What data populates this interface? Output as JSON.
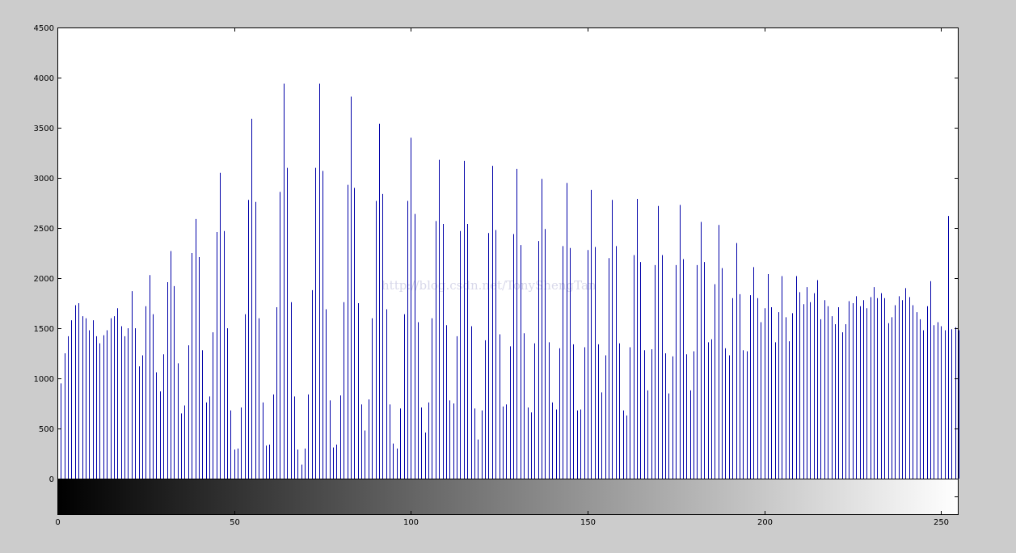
{
  "figure": {
    "background_color": "#cccccc",
    "axes_background_color": "#ffffff",
    "watermark": "http://blog.csdn.net/TonyShengTan"
  },
  "chart_data": {
    "type": "bar",
    "subtype": "stem",
    "title": "",
    "xlabel": "",
    "ylabel": "",
    "xlim": [
      0,
      255
    ],
    "ylim": [
      0,
      4500
    ],
    "xticks": [
      0,
      50,
      100,
      150,
      200,
      250
    ],
    "yticks": [
      0,
      500,
      1000,
      1500,
      2000,
      2500,
      3000,
      3500,
      4000,
      4500
    ],
    "grid": false,
    "legend": "none",
    "bar_color": "#0000a8",
    "colorbar": {
      "range": [
        0,
        255
      ],
      "from_color": "#000000",
      "to_color": "#ffffff"
    },
    "x": [
      0,
      1,
      2,
      3,
      4,
      5,
      6,
      7,
      8,
      9,
      10,
      11,
      12,
      13,
      14,
      15,
      16,
      17,
      18,
      19,
      20,
      21,
      22,
      23,
      24,
      25,
      26,
      27,
      28,
      29,
      30,
      31,
      32,
      33,
      34,
      35,
      36,
      37,
      38,
      39,
      40,
      41,
      42,
      43,
      44,
      45,
      46,
      47,
      48,
      49,
      50,
      51,
      52,
      53,
      54,
      55,
      56,
      57,
      58,
      59,
      60,
      61,
      62,
      63,
      64,
      65,
      66,
      67,
      68,
      69,
      70,
      71,
      72,
      73,
      74,
      75,
      76,
      77,
      78,
      79,
      80,
      81,
      82,
      83,
      84,
      85,
      86,
      87,
      88,
      89,
      90,
      91,
      92,
      93,
      94,
      95,
      96,
      97,
      98,
      99,
      100,
      101,
      102,
      103,
      104,
      105,
      106,
      107,
      108,
      109,
      110,
      111,
      112,
      113,
      114,
      115,
      116,
      117,
      118,
      119,
      120,
      121,
      122,
      123,
      124,
      125,
      126,
      127,
      128,
      129,
      130,
      131,
      132,
      133,
      134,
      135,
      136,
      137,
      138,
      139,
      140,
      141,
      142,
      143,
      144,
      145,
      146,
      147,
      148,
      149,
      150,
      151,
      152,
      153,
      154,
      155,
      156,
      157,
      158,
      159,
      160,
      161,
      162,
      163,
      164,
      165,
      166,
      167,
      168,
      169,
      170,
      171,
      172,
      173,
      174,
      175,
      176,
      177,
      178,
      179,
      180,
      181,
      182,
      183,
      184,
      185,
      186,
      187,
      188,
      189,
      190,
      191,
      192,
      193,
      194,
      195,
      196,
      197,
      198,
      199,
      200,
      201,
      202,
      203,
      204,
      205,
      206,
      207,
      208,
      209,
      210,
      211,
      212,
      213,
      214,
      215,
      216,
      217,
      218,
      219,
      220,
      221,
      222,
      223,
      224,
      225,
      226,
      227,
      228,
      229,
      230,
      231,
      232,
      233,
      234,
      235,
      236,
      237,
      238,
      239,
      240,
      241,
      242,
      243,
      244,
      245,
      246,
      247,
      248,
      249,
      250,
      251,
      252,
      253,
      254,
      255
    ],
    "values": [
      1480,
      950,
      1250,
      1420,
      1580,
      1730,
      1750,
      1620,
      1600,
      1480,
      1580,
      1420,
      1350,
      1430,
      1480,
      1600,
      1620,
      1700,
      1520,
      1420,
      1500,
      1870,
      1500,
      1120,
      1230,
      1720,
      2030,
      1640,
      1060,
      870,
      1240,
      1960,
      2270,
      1920,
      1150,
      650,
      730,
      1330,
      2250,
      2590,
      2210,
      1280,
      760,
      820,
      1460,
      2460,
      3050,
      2470,
      1500,
      680,
      290,
      300,
      710,
      1640,
      2780,
      3590,
      2760,
      1600,
      760,
      330,
      340,
      840,
      1710,
      2860,
      3940,
      3100,
      1760,
      820,
      290,
      140,
      300,
      840,
      1880,
      3100,
      3940,
      3070,
      1690,
      780,
      310,
      340,
      830,
      1760,
      2930,
      3810,
      2900,
      1750,
      740,
      480,
      790,
      1600,
      2770,
      3540,
      2840,
      1690,
      740,
      350,
      300,
      700,
      1640,
      2770,
      3400,
      2640,
      1560,
      710,
      460,
      760,
      1600,
      2570,
      3180,
      2540,
      1530,
      780,
      750,
      1420,
      2470,
      3170,
      2540,
      1520,
      700,
      390,
      680,
      1380,
      2450,
      3120,
      2480,
      1440,
      720,
      740,
      1320,
      2440,
      3090,
      2330,
      1450,
      710,
      660,
      1350,
      2370,
      2990,
      2490,
      1360,
      760,
      690,
      1300,
      2320,
      2950,
      2300,
      1340,
      680,
      690,
      1310,
      2280,
      2880,
      2310,
      1340,
      860,
      1230,
      2200,
      2780,
      2320,
      1350,
      680,
      630,
      1310,
      2230,
      2790,
      2160,
      1280,
      880,
      1290,
      2130,
      2720,
      2230,
      1250,
      850,
      1220,
      2130,
      2730,
      2190,
      1240,
      880,
      1270,
      2130,
      2560,
      2160,
      1360,
      1390,
      1940,
      2530,
      2100,
      1300,
      1230,
      1800,
      2350,
      1840,
      1280,
      1270,
      1830,
      2110,
      1800,
      1560,
      1700,
      2040,
      1710,
      1360,
      1660,
      2020,
      1610,
      1370,
      1650,
      2020,
      1860,
      1740,
      1910,
      1760,
      1850,
      1980,
      1590,
      1780,
      1720,
      1620,
      1540,
      1710,
      1460,
      1540,
      1770,
      1750,
      1820,
      1720,
      1780,
      1700,
      1810,
      1910,
      1800,
      1850,
      1800,
      1550,
      1610,
      1730,
      1820,
      1780,
      1900,
      1810,
      1730,
      1660,
      1590,
      1480,
      1720,
      1970,
      1530,
      1560,
      1520,
      1480,
      2620,
      1490,
      1510,
      1480
    ]
  }
}
